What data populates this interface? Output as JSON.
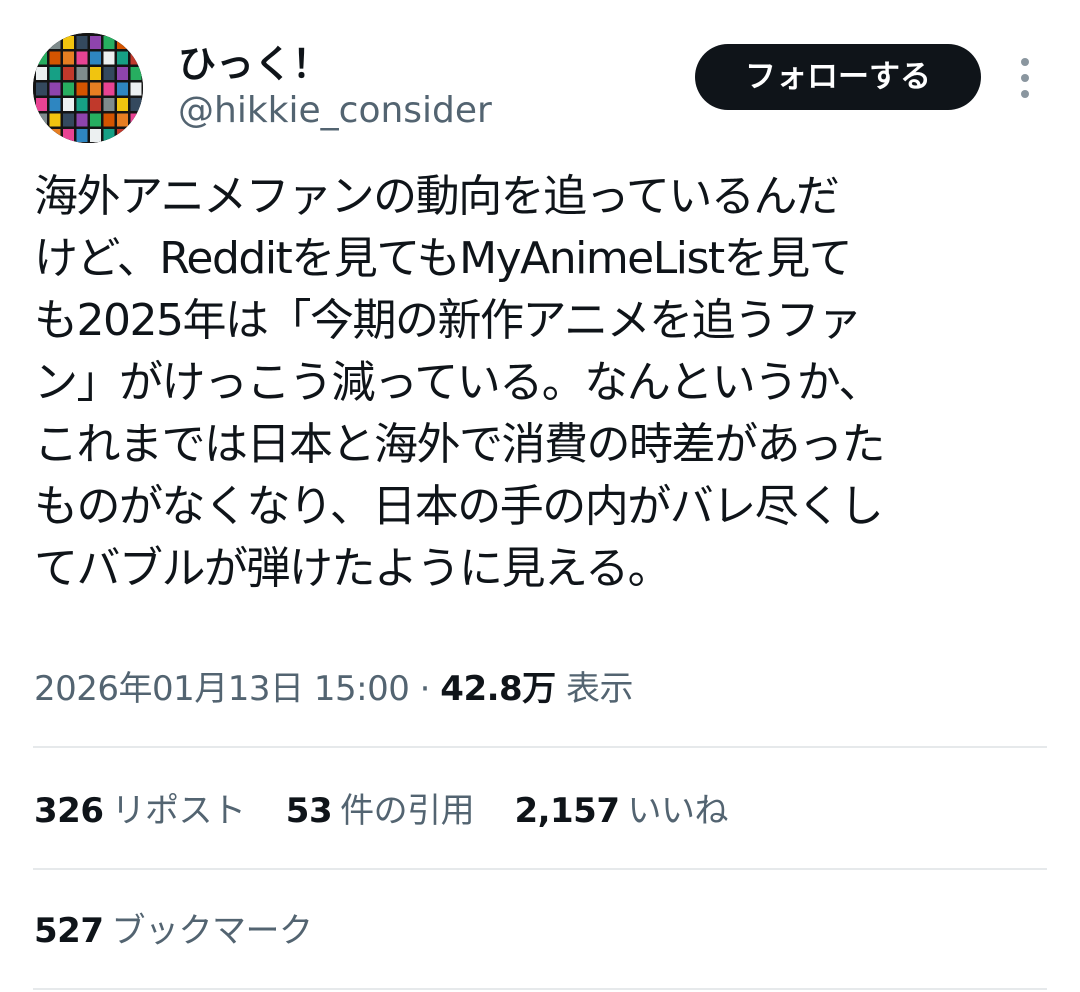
{
  "user": {
    "display_name": "ひっく！",
    "handle": "@hikkie_consider"
  },
  "actions": {
    "follow_label": "フォローする"
  },
  "tweet": {
    "lines": [
      "海外アニメファンの動向を追っているんだ",
      "けど、Redditを見てもMyAnimeListを見て",
      "も2025年は「今期の新作アニメを追うファ",
      "ン」がけっこう減っている。なんというか、",
      "これまでは日本と海外で消費の時差があった",
      "ものがなくなり、日本の手の内がバレ尽くし",
      "てバブルが弾けたように見える。"
    ]
  },
  "meta": {
    "timestamp": "2026年01月13日 15:00",
    "separator": "·",
    "views_count": "42.8万",
    "views_label": "表示"
  },
  "stats": {
    "reposts": {
      "count": "326",
      "label": "リポスト"
    },
    "quotes": {
      "count": "53",
      "label": "件の引用"
    },
    "likes": {
      "count": "2,157",
      "label": "いいね"
    },
    "bookmarks": {
      "count": "527",
      "label": "ブックマーク"
    }
  },
  "colors": {
    "text_primary": "#0f1419",
    "text_secondary": "#536471",
    "button_bg": "#0f1419",
    "divider": "#e6e9eb"
  }
}
